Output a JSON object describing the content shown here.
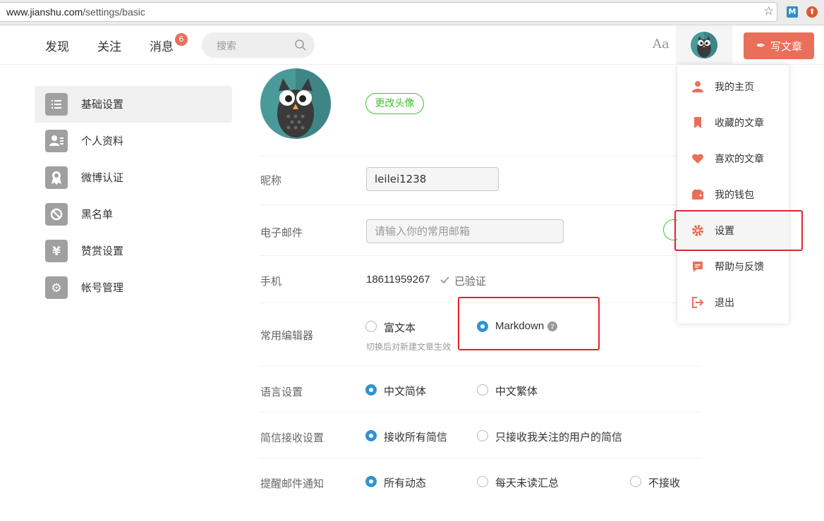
{
  "browser": {
    "url_host": "www.jianshu.com",
    "url_path": "/settings/basic",
    "ext1": "M",
    "ext2": "⬆"
  },
  "nav": {
    "discover": "发现",
    "follow": "关注",
    "messages": "消息",
    "messages_badge": "6",
    "search_placeholder": "搜索",
    "font_toggle": "Aa",
    "write_label": "写文章",
    "write_icon": "✒"
  },
  "sidebar": {
    "items": [
      {
        "label": "基础设置",
        "icon": "list-icon",
        "glyph": "☰",
        "active": true
      },
      {
        "label": "个人资料",
        "icon": "profile-card-icon",
        "glyph": "▣",
        "active": false
      },
      {
        "label": "微博认证",
        "icon": "badge-icon",
        "glyph": "✪",
        "active": false
      },
      {
        "label": "黑名单",
        "icon": "ban-icon",
        "glyph": "⊘",
        "active": false
      },
      {
        "label": "赞赏设置",
        "icon": "yen-icon",
        "glyph": "¥",
        "active": false
      },
      {
        "label": "帐号管理",
        "icon": "gear-icon",
        "glyph": "⚙",
        "active": false
      }
    ]
  },
  "form": {
    "change_avatar": "更改头像",
    "nickname_label": "昵称",
    "nickname_value": "leilei1238",
    "email_label": "电子邮件",
    "email_placeholder": "请输入你的常用邮箱",
    "phone_label": "手机",
    "phone_value": "18611959267",
    "phone_verified": "已验证",
    "editor_label": "常用编辑器",
    "editor_options": [
      "富文本",
      "Markdown"
    ],
    "editor_hint": "切换后对新建文章生效",
    "language_label": "语言设置",
    "language_options": [
      "中文简体",
      "中文繁体"
    ],
    "sms_label": "简信接收设置",
    "sms_options": [
      "接收所有简信",
      "只接收我关注的用户的简信"
    ],
    "email_notify_label": "提醒邮件通知",
    "email_notify_options": [
      "所有动态",
      "每天未读汇总",
      "不接收"
    ]
  },
  "dropdown": {
    "items": [
      {
        "label": "我的主页",
        "icon": "user-icon"
      },
      {
        "label": "收藏的文章",
        "icon": "bookmark-icon"
      },
      {
        "label": "喜欢的文章",
        "icon": "heart-icon"
      },
      {
        "label": "我的钱包",
        "icon": "wallet-icon"
      },
      {
        "label": "设置",
        "icon": "gear-icon"
      },
      {
        "label": "帮助与反馈",
        "icon": "feedback-icon"
      },
      {
        "label": "退出",
        "icon": "logout-icon"
      }
    ]
  },
  "colors": {
    "accent": "#ea6f5a",
    "green": "#42c02e",
    "radio_blue": "#3194d0",
    "highlight_red": "#e0242c"
  }
}
